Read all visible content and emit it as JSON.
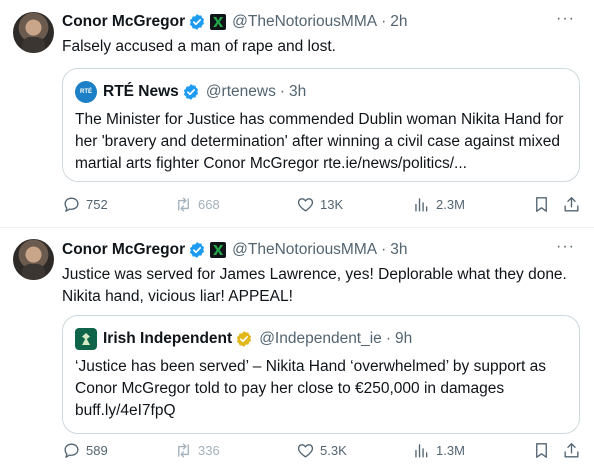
{
  "colors": {
    "verified_blue": "#1d9bf0",
    "affiliate_gold": "#e2b719",
    "text": "#0f1419",
    "muted": "#536471",
    "border": "#cfd9de"
  },
  "tweets": [
    {
      "author": {
        "name": "Conor McGregor",
        "handle": "@TheNotoriousMMA",
        "time": "2h",
        "verified": true,
        "affiliate_icon": "proper-twelve-logo-icon"
      },
      "text": "Falsely accused a man of rape and lost.",
      "quote": {
        "avatar_text": "RTÉ News",
        "name": "RTÉ News",
        "handle": "@rtenews",
        "time": "3h",
        "badge": "blue",
        "text": "The Minister for Justice has commended Dublin woman Nikita Hand for her 'bravery and determination' after winning a civil case against mixed martial arts fighter Conor McGregor rte.ie/news/politics/..."
      },
      "actions": {
        "replies": "752",
        "reposts": "668",
        "likes": "13K",
        "views": "2.3M"
      }
    },
    {
      "author": {
        "name": "Conor McGregor",
        "handle": "@TheNotoriousMMA",
        "time": "3h",
        "verified": true,
        "affiliate_icon": "proper-twelve-logo-icon"
      },
      "text": "Justice was served for James Lawrence, yes! Deplorable what they done. Nikita hand, vicious liar! APPEAL!",
      "quote": {
        "name": "Irish Independent",
        "handle": "@Independent_ie",
        "time": "9h",
        "badge": "gold",
        "text": "‘Justice has been served’ – Nikita Hand ‘overwhelmed’ by support as Conor McGregor told to pay her close to €250,000 in damages buff.ly/4eI7fpQ"
      },
      "actions": {
        "replies": "589",
        "reposts": "336",
        "likes": "5.3K",
        "views": "1.3M"
      }
    }
  ],
  "symbols": {
    "dot": "·",
    "more": "···"
  }
}
